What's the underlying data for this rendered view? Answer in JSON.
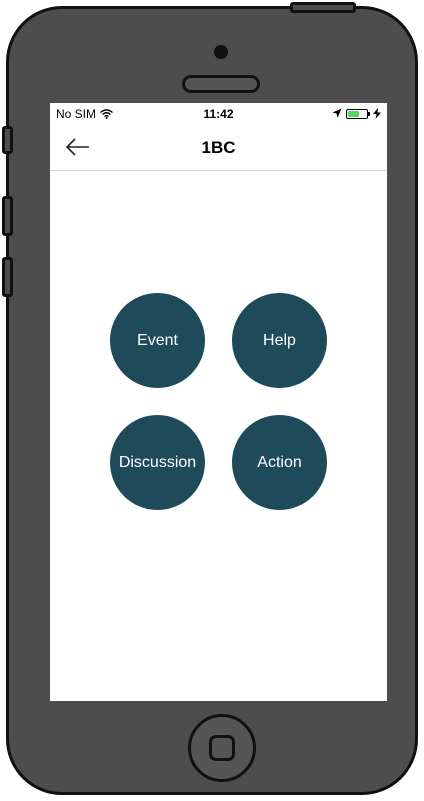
{
  "status_bar": {
    "carrier": "No SIM",
    "time": "11:42",
    "battery_level": 0.6,
    "battery_color": "#4cd964"
  },
  "nav": {
    "title": "1BC",
    "back_icon": "arrow-left-icon"
  },
  "actions": {
    "event": "Event",
    "help": "Help",
    "discussion": "Discussion",
    "action": "Action"
  },
  "colors": {
    "button_fill": "#1e4a5a",
    "phone_body": "#4d4d4d"
  }
}
